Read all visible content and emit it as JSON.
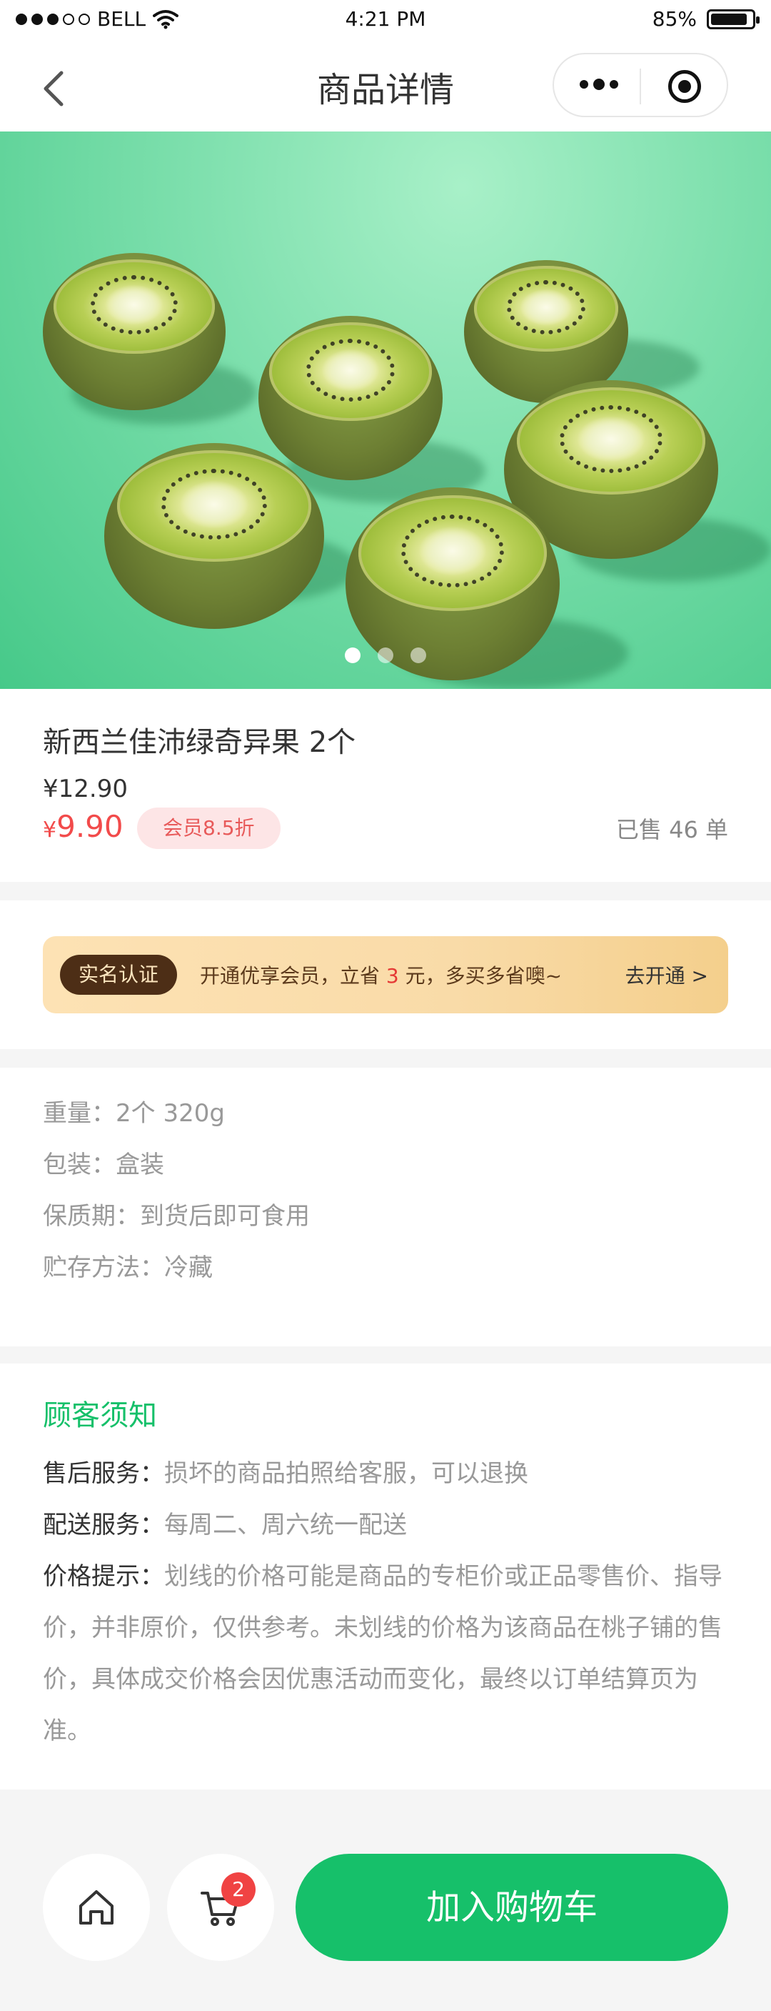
{
  "status_bar": {
    "carrier": "BELL",
    "time": "4:21 PM",
    "battery": "85%"
  },
  "nav": {
    "title": "商品详情"
  },
  "carousel": {
    "count": 3,
    "active": 0
  },
  "product": {
    "name": "新西兰佳沛绿奇异果 2个",
    "original_price": "¥12.90",
    "price_symbol": "¥",
    "price": "9.90",
    "member_discount": "会员8.5折",
    "sold": "已售 46 单"
  },
  "promo": {
    "badge": "实名认证",
    "text_before": "开通优享会员，立省 ",
    "save_amount": "3",
    "text_after": " 元，多买多省噢~",
    "action": "去开通 >"
  },
  "specs": [
    "重量：2个  320g",
    "包装：盒装",
    "保质期：到货后即可食用",
    "贮存方法：冷藏"
  ],
  "notice": {
    "title": "顾客须知",
    "items": [
      {
        "label": "售后服务：",
        "text": "损坏的商品拍照给客服，可以退换"
      },
      {
        "label": "配送服务：",
        "text": "每周二、周六统一配送"
      },
      {
        "label": "价格提示：",
        "text": "划线的价格可能是商品的专柜价或正品零售价、指导价，并非原价，仅供参考。未划线的价格为该商品在桃子铺的售价，具体成交价格会因优惠活动而变化，最终以订单结算页为准。"
      }
    ]
  },
  "bottom": {
    "cart_count": "2",
    "add_to_cart": "加入购物车"
  },
  "colors": {
    "brand_green": "#16c06a",
    "price_red": "#f24b4b"
  }
}
